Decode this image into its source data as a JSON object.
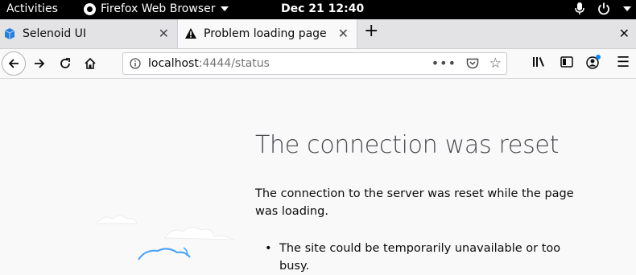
{
  "topbar": {
    "activities": "Activities",
    "app_name": "Firefox Web Browser",
    "clock": "Dec 21  12:40",
    "icons": [
      "firefox-icon",
      "mic-icon",
      "power-icon",
      "chevron-down-icon"
    ]
  },
  "tabs": [
    {
      "title": "Selenoid UI",
      "icon": "selenoid-cube-icon",
      "active": false
    },
    {
      "title": "Problem loading page",
      "icon": "warning-icon",
      "active": true
    }
  ],
  "toolbar": {
    "url_host": "localhost",
    "url_rest": ":4444/status",
    "icons": [
      "back-icon",
      "forward-icon",
      "reload-icon",
      "home-icon",
      "info-icon",
      "page-actions-icon",
      "pocket-icon",
      "bookmark-star-icon",
      "library-icon",
      "sidebar-icon",
      "account-icon",
      "menu-icon"
    ]
  },
  "error_page": {
    "title": "The connection was reset",
    "description": "The connection to the server was reset while the page was loading.",
    "bullets": [
      "The site could be temporarily unavailable or too busy."
    ]
  },
  "colors": {
    "topbar_bg": "#000000",
    "tabstrip_bg": "#e3e3e6",
    "page_bg": "#f9f9fa",
    "title_color": "#4a4a4f",
    "illustration_blue": "#45a1ff",
    "account_dot": "#0a84ff"
  }
}
